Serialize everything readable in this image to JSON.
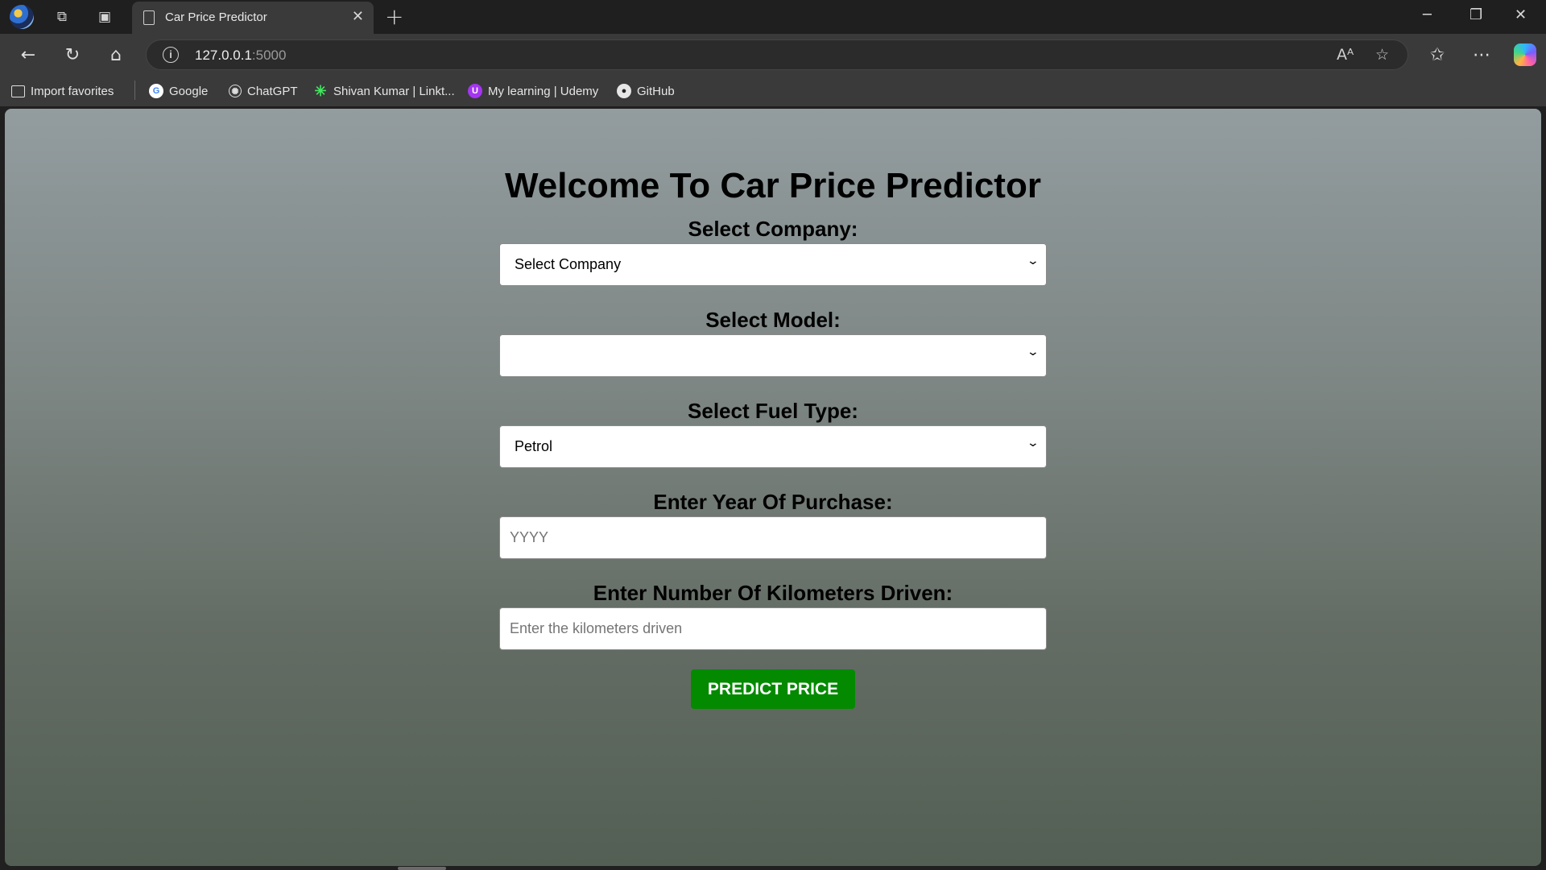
{
  "browser": {
    "tab_title": "Car Price Predictor",
    "url_host": "127.0.0.1",
    "url_port": ":5000",
    "favorites": [
      {
        "label": "Import favorites",
        "icon": "import-icon"
      },
      {
        "label": "Google",
        "icon": "google-icon",
        "color": "#4285f4"
      },
      {
        "label": "ChatGPT",
        "icon": "chatgpt-icon"
      },
      {
        "label": "Shivan Kumar | Linkt...",
        "icon": "linktree-icon",
        "color": "#43e660"
      },
      {
        "label": "My learning | Udemy",
        "icon": "udemy-icon",
        "color": "#a435f0"
      },
      {
        "label": "GitHub",
        "icon": "github-icon"
      }
    ]
  },
  "page": {
    "title": "Welcome To Car Price Predictor",
    "company_label": "Select Company:",
    "company_value": "Select Company",
    "model_label": "Select Model:",
    "model_value": "",
    "fuel_label": "Select Fuel Type:",
    "fuel_value": "Petrol",
    "year_label": "Enter Year Of Purchase:",
    "year_placeholder": "YYYY",
    "km_label": "Enter Number Of Kilometers Driven:",
    "km_placeholder": "Enter the kilometers driven",
    "predict_button": "PREDICT PRICE",
    "button_color": "#048a00"
  }
}
